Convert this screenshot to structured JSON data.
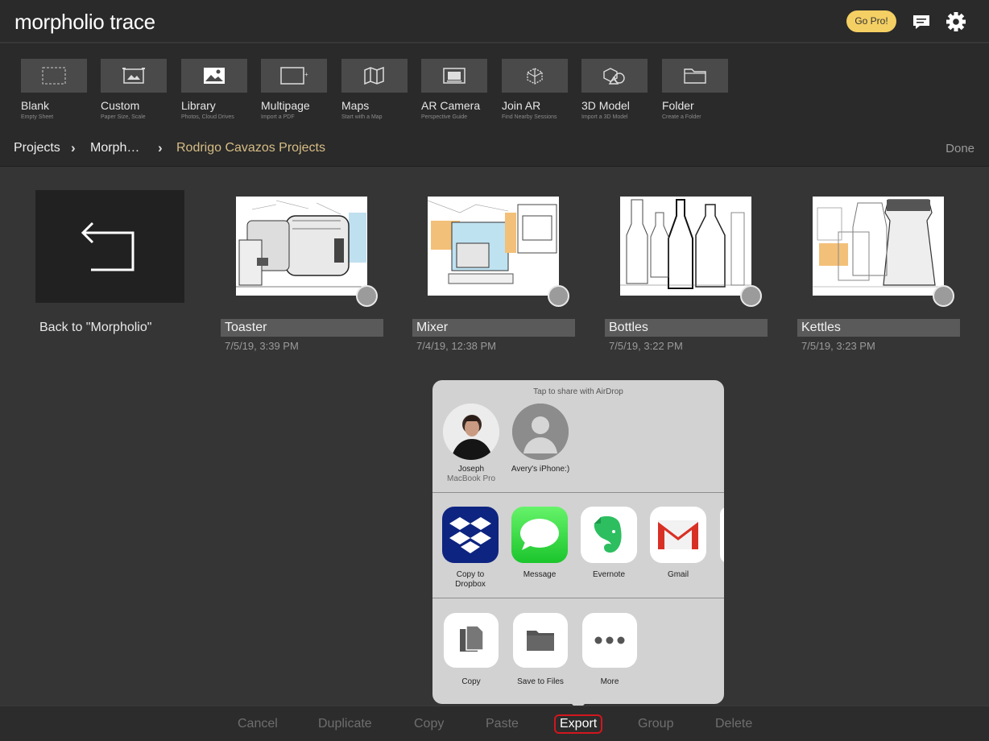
{
  "app": {
    "brand_light": "morpholio",
    "brand_bold": "trace",
    "go_pro": "Go Pro!"
  },
  "tools": [
    {
      "label": "Blank",
      "sub": "Empty Sheet",
      "icon": "blank-sheet-icon"
    },
    {
      "label": "Custom",
      "sub": "Paper Size, Scale",
      "icon": "custom-size-icon"
    },
    {
      "label": "Library",
      "sub": "Photos, Cloud Drives",
      "icon": "image-icon"
    },
    {
      "label": "Multipage",
      "sub": "Import a PDF",
      "icon": "multipage-icon"
    },
    {
      "label": "Maps",
      "sub": "Start with a Map",
      "icon": "map-icon"
    },
    {
      "label": "AR Camera",
      "sub": "Perspective Guide",
      "icon": "ar-camera-icon"
    },
    {
      "label": "Join AR",
      "sub": "Find Nearby Sessions",
      "icon": "cube-icon"
    },
    {
      "label": "3D Model",
      "sub": "Import a 3D Model",
      "icon": "shapes-icon"
    },
    {
      "label": "Folder",
      "sub": "Create a Folder",
      "icon": "folder-icon"
    }
  ],
  "breadcrumb": {
    "root": "Projects",
    "middle": "Morph…",
    "current": "Rodrigo Cavazos Projects",
    "done": "Done"
  },
  "back": {
    "label": "Back to \"Morpholio\""
  },
  "projects": [
    {
      "name": "Toaster",
      "date": "7/5/19, 3:39 PM"
    },
    {
      "name": "Mixer",
      "date": "7/4/19, 12:38 PM"
    },
    {
      "name": "Bottles",
      "date": "7/5/19, 3:22 PM"
    },
    {
      "name": "Kettles",
      "date": "7/5/19, 3:23 PM"
    }
  ],
  "share": {
    "airdrop_hint": "Tap to share with AirDrop",
    "people": [
      {
        "name": "Joseph",
        "device": "MacBook Pro"
      },
      {
        "name": "Avery's iPhone:)",
        "device": ""
      }
    ],
    "apps": [
      {
        "line1": "Copy to",
        "line2": "Dropbox"
      },
      {
        "line1": "Message",
        "line2": ""
      },
      {
        "line1": "Evernote",
        "line2": ""
      },
      {
        "line1": "Gmail",
        "line2": ""
      }
    ],
    "actions": [
      {
        "label": "Copy"
      },
      {
        "label": "Save to Files"
      },
      {
        "label": "More"
      }
    ]
  },
  "bottom": {
    "cancel": "Cancel",
    "duplicate": "Duplicate",
    "copy": "Copy",
    "paste": "Paste",
    "export": "Export",
    "group": "Group",
    "delete": "Delete"
  },
  "colors": {
    "accent": "#d7bd85",
    "go_pro": "#f4cf63",
    "export_outline": "#d2161e"
  }
}
